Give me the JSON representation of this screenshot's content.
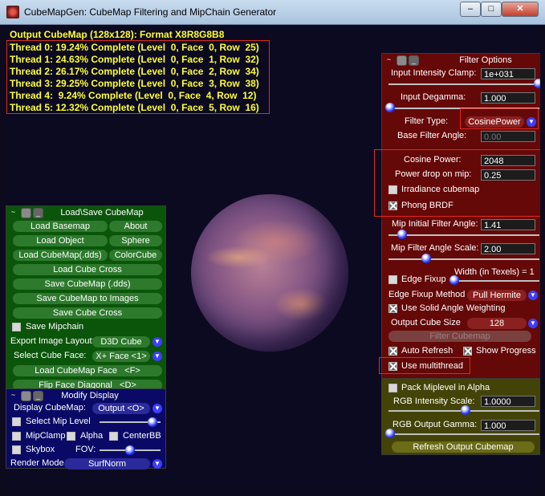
{
  "window": {
    "title": "CubeMapGen: CubeMap Filtering and MipChain Generator",
    "min": "–",
    "max": "□",
    "close": "✕"
  },
  "status": {
    "output": "Output CubeMap (128x128): Format X8R8G8B8",
    "threads": [
      "Thread 0: 19.24% Complete (Level  0, Face  0, Row  25)",
      "Thread 1: 24.63% Complete (Level  0, Face  1, Row  32)",
      "Thread 2: 26.17% Complete (Level  0, Face  2, Row  34)",
      "Thread 3: 29.25% Complete (Level  0, Face  3, Row  38)",
      "Thread 4:  9.24% Complete (Level  0, Face  4, Row  12)",
      "Thread 5: 12.32% Complete (Level  0, Face  5, Row  16)"
    ]
  },
  "load_panel": {
    "title": "Load\\Save CubeMap",
    "load_basemap": "Load Basemap",
    "about": "About",
    "load_object": "Load Object",
    "sphere": "Sphere",
    "load_cubemap": "Load CubeMap(.dds)",
    "colorcube": "ColorCube",
    "load_cube_cross": "Load Cube Cross",
    "save_cubemap": "Save CubeMap (.dds)",
    "save_to_images": "Save CubeMap to Images",
    "save_cube_cross": "Save Cube Cross",
    "save_mipchain": "Save Mipchain",
    "export_layout_label": "Export Image Layout:",
    "export_layout_value": "D3D Cube",
    "select_face_label": "Select Cube Face:",
    "select_face_value": "X+ Face <1>",
    "load_face": "Load CubeMap Face   <F>",
    "flip_face": "Flip Face Diagonal   <D>"
  },
  "display_panel": {
    "title": "Modify Display",
    "display_cubemap_label": "Display CubeMap:",
    "display_cubemap_value": "Output <O>",
    "select_mip_level": "Select Mip Level",
    "mipclamp": "MipClamp",
    "alpha": "Alpha",
    "centerbb": "CenterBB",
    "skybox": "Skybox",
    "fov": "FOV:",
    "render_mode_label": "Render Mode",
    "render_mode_value": "SurfNorm"
  },
  "filter_panel": {
    "title": "Filter Options",
    "input_intensity_clamp_label": "Input Intensity Clamp:",
    "input_intensity_clamp_value": "1e+031",
    "input_degamma_label": "Input Degamma:",
    "input_degamma_value": "1.000",
    "filter_type_label": "Filter Type:",
    "filter_type_value": "CosinePower",
    "base_filter_angle_label": "Base Filter Angle:",
    "base_filter_angle_value": "0.00",
    "cosine_power_label": "Cosine Power:",
    "cosine_power_value": "2048",
    "power_drop_label": "Power drop on mip:",
    "power_drop_value": "0.25",
    "irradiance_cubemap": "Irradiance cubemap",
    "phong_brdf": "Phong BRDF",
    "mip_initial_label": "Mip Initial Filter Angle:",
    "mip_initial_value": "1.41",
    "mip_scale_label": "Mip Filter Angle Scale:",
    "mip_scale_value": "2.00",
    "width_texels": "Width (in Texels) = 1",
    "edge_fixup": "Edge Fixup",
    "edge_fixup_method_label": "Edge Fixup Method",
    "edge_fixup_method_value": "Pull Hermite",
    "solid_angle": "Use Solid Angle Weighting",
    "output_size_label": "Output Cube Size",
    "output_size_value": "128",
    "filter_cubemap": "Filter Cubemap",
    "auto_refresh": "Auto Refresh",
    "show_progress": "Show Progress",
    "use_multithread": "Use multithread",
    "pack_mip_alpha": "Pack Miplevel in Alpha",
    "rgb_intensity_label": "RGB Intensity Scale:",
    "rgb_intensity_value": "1.0000",
    "rgb_gamma_label": "RGB Output Gamma:",
    "rgb_gamma_value": "1.000",
    "refresh_output": "Refresh Output Cubemap"
  },
  "colors": {
    "status_text": "#ffff33",
    "highlight_box": "#e02a1a",
    "load_panel_bg": "#0a5a0a",
    "display_panel_bg": "#0a0a6a",
    "filter_panel_bg": "#6a0a0a",
    "bottom_panel_bg": "#4a4a08"
  }
}
